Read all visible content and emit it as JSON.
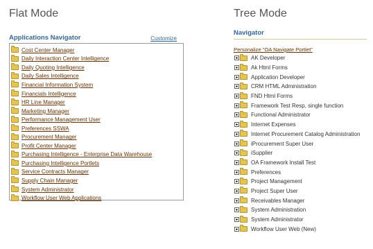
{
  "flat": {
    "title": "Flat Mode",
    "heading": "Applications Navigator",
    "customize": "Customize",
    "items": [
      "Cost Center Manager",
      "Daily Interaction Center Intelligence",
      "Daily Quoting Intelligence",
      "Daily Sales Intelligence",
      "Financial Information System",
      "Financials Intelligence",
      "HR Line Manager",
      "Marketing Manager",
      "Performance Management User",
      "Preferences SSWA",
      "Procurement Manager",
      "Profit Center Manager",
      "Purchasing Intelligence - Enterprise Data Warehouse",
      "Purchasing Intelligence Portlets",
      "Service Contracts Manager",
      "Supply Chain Manager",
      "System Administrator",
      "Workflow User Web Applications"
    ]
  },
  "tree": {
    "title": "Tree Mode",
    "heading": "Navigator",
    "personalize": "Personalize \"OA Navigate Portlet\"",
    "items": [
      "AK Developer",
      "Ak Html Forms",
      "Application Developer",
      "CRM HTML Administration",
      "FND Html Forms",
      "Framework Test Resp, single function",
      "Functional Administrator",
      "Internet Expenses",
      "Internet Procurement Catalog Administration",
      "iProcurement Super User",
      "iSupplier",
      "OA Framework Install Test",
      "Preferences",
      "Project Management",
      "Project Super User",
      "Receivables Manager",
      "System Administration",
      "System Administrator",
      "Workflow User Web (New)"
    ]
  },
  "colors": {
    "heading": "#336699",
    "link": "#663300",
    "folder": "#e6c452"
  },
  "icons": {
    "folder": "folder-icon",
    "expand": "expand-plus-icon"
  }
}
